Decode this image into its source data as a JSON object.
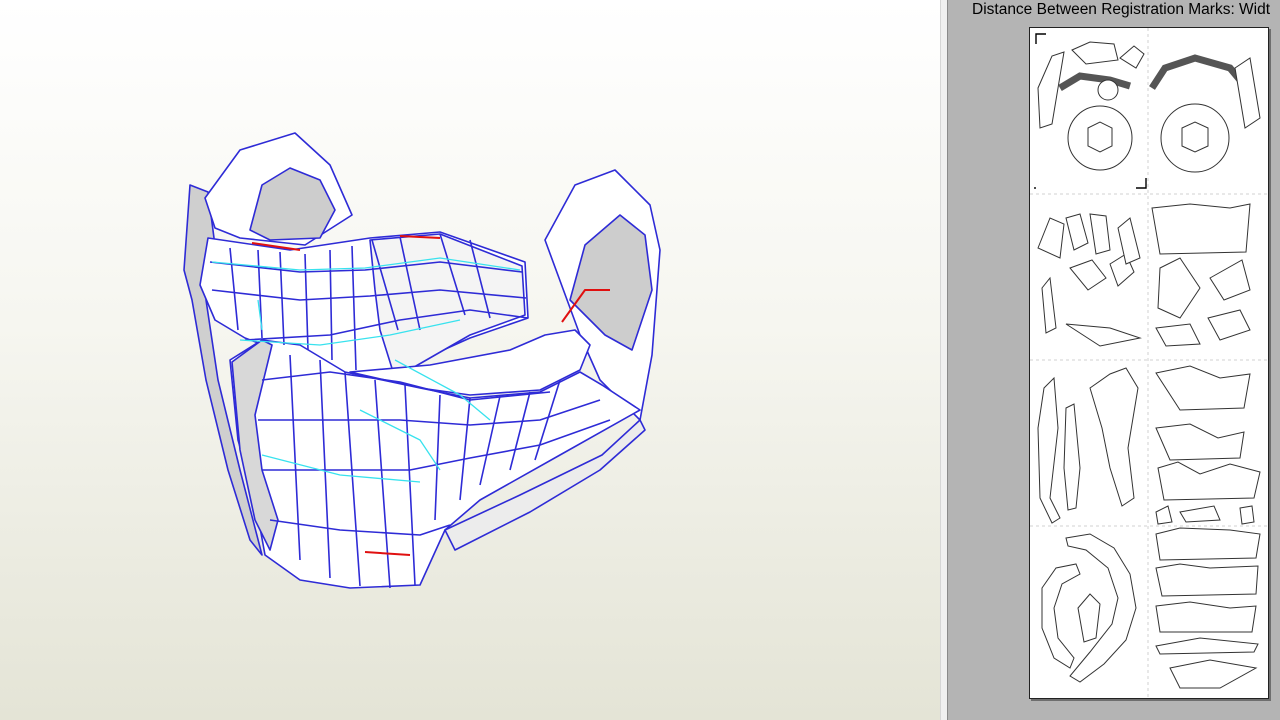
{
  "app": {
    "panels": [
      "3d-view",
      "2d-unfold-view"
    ]
  },
  "view2d": {
    "registration_label": "Distance Between Registration Marks: Widt"
  },
  "colors": {
    "edge_blue": "#2e2bd6",
    "fold_cyan": "#38e2ee",
    "cut_red": "#e01010",
    "face_white": "#ffffff",
    "face_grey": "#cdcdcd",
    "sheet_bg": "#ffffff",
    "panel_bg": "#b4b4b4"
  }
}
